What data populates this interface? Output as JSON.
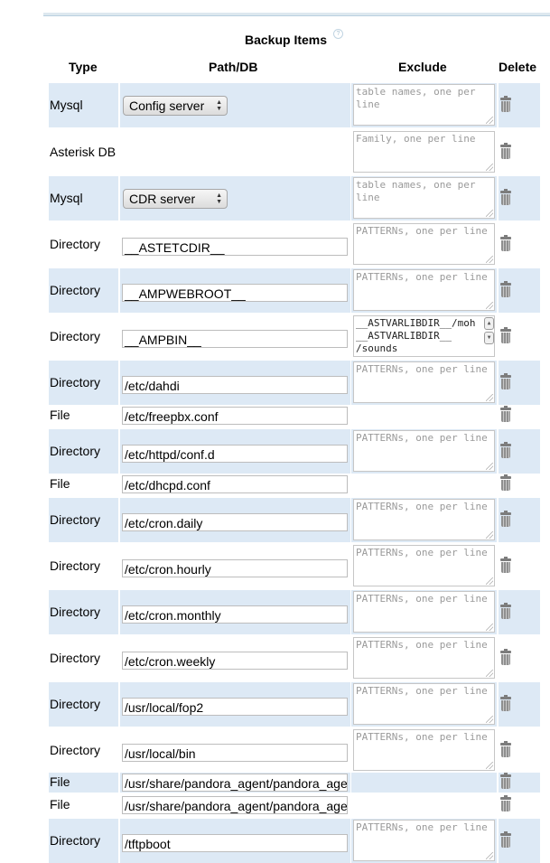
{
  "section_title": "Backup Items",
  "help_glyph": "?",
  "columns": {
    "type": "Type",
    "path": "Path/DB",
    "exclude": "Exclude",
    "delete": "Delete"
  },
  "rows": [
    {
      "type": "Mysql",
      "select": "Config server",
      "exclude_placeholder": "table names, one per line"
    },
    {
      "type": "Asterisk DB",
      "exclude_placeholder": "Family, one per line"
    },
    {
      "type": "Mysql",
      "select": "CDR server",
      "exclude_placeholder": "table names, one per line"
    },
    {
      "type": "Directory",
      "path": "__ASTETCDIR__",
      "exclude_placeholder": "PATTERNs, one per line"
    },
    {
      "type": "Directory",
      "path": "__AMPWEBROOT__",
      "exclude_placeholder": "PATTERNs, one per line"
    },
    {
      "type": "Directory",
      "path": "__AMPBIN__",
      "exclude_value": "__ASTVARLIBDIR__/moh\n__ASTVARLIBDIR__\n/sounds"
    },
    {
      "type": "Directory",
      "path": "/etc/dahdi",
      "exclude_placeholder": "PATTERNs, one per line"
    },
    {
      "type": "File",
      "path": "/etc/freepbx.conf"
    },
    {
      "type": "Directory",
      "path": "/etc/httpd/conf.d",
      "exclude_placeholder": "PATTERNs, one per line"
    },
    {
      "type": "File",
      "path": "/etc/dhcpd.conf"
    },
    {
      "type": "Directory",
      "path": "/etc/cron.daily",
      "exclude_placeholder": "PATTERNs, one per line"
    },
    {
      "type": "Directory",
      "path": "/etc/cron.hourly",
      "exclude_placeholder": "PATTERNs, one per line"
    },
    {
      "type": "Directory",
      "path": "/etc/cron.monthly",
      "exclude_placeholder": "PATTERNs, one per line"
    },
    {
      "type": "Directory",
      "path": "/etc/cron.weekly",
      "exclude_placeholder": "PATTERNs, one per line"
    },
    {
      "type": "Directory",
      "path": "/usr/local/fop2",
      "exclude_placeholder": "PATTERNs, one per line"
    },
    {
      "type": "Directory",
      "path": "/usr/local/bin",
      "exclude_placeholder": "PATTERNs, one per line"
    },
    {
      "type": "File",
      "path": "/usr/share/pandora_agent/pandora_agent.conf"
    },
    {
      "type": "File",
      "path": "/usr/share/pandora_agent/pandora_agent_daemon"
    },
    {
      "type": "Directory",
      "path": "/tftpboot",
      "exclude_placeholder": "PATTERNs, one per line"
    }
  ],
  "icons": {
    "delete": "trash-icon",
    "help": "help-icon",
    "select_arrows": "updown-arrows-icon"
  },
  "colors": {
    "row_shade": "#dde9f5",
    "divider": "#b9cfe0"
  }
}
